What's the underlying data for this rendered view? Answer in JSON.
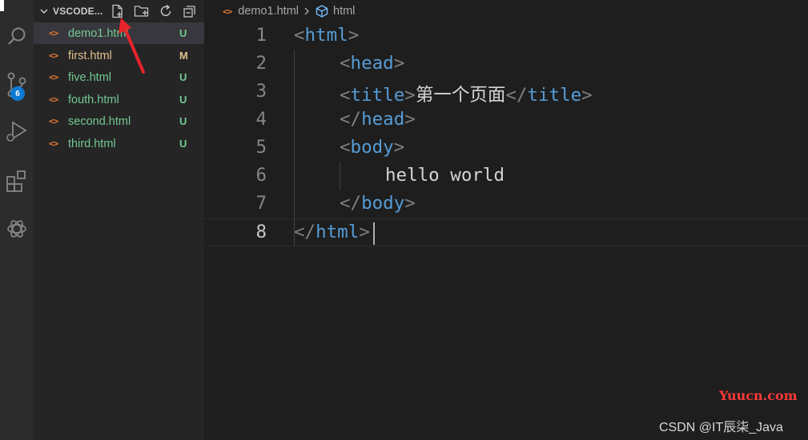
{
  "sidebar": {
    "title": "VSCODE...",
    "files": [
      {
        "name": "demo1.html",
        "status": "U",
        "selected": true
      },
      {
        "name": "first.html",
        "status": "M",
        "selected": false
      },
      {
        "name": "five.html",
        "status": "U",
        "selected": false
      },
      {
        "name": "fouth.html",
        "status": "U",
        "selected": false
      },
      {
        "name": "second.html",
        "status": "U",
        "selected": false
      },
      {
        "name": "third.html",
        "status": "U",
        "selected": false
      }
    ]
  },
  "activity": {
    "source_control_badge": "6"
  },
  "breadcrumb": {
    "file": "demo1.html",
    "symbol": "html"
  },
  "editor": {
    "current_line": 8,
    "lines": [
      {
        "n": "1",
        "tag": "html",
        "close": false,
        "text": ""
      },
      {
        "n": "2",
        "tag": "head",
        "close": false,
        "text": ""
      },
      {
        "n": "3",
        "tag": "title",
        "close": false,
        "text": "第一个页面"
      },
      {
        "n": "4",
        "tag": "head",
        "close": true,
        "text": ""
      },
      {
        "n": "5",
        "tag": "body",
        "close": false,
        "text": ""
      },
      {
        "n": "6",
        "tag": "",
        "close": false,
        "text": "hello world"
      },
      {
        "n": "7",
        "tag": "body",
        "close": true,
        "text": ""
      },
      {
        "n": "8",
        "tag": "html",
        "close": true,
        "text": ""
      }
    ]
  },
  "watermarks": {
    "site": "Yuucn.com",
    "author": "CSDN @IT辰柒_Java"
  },
  "colors": {
    "accent": "#0e7ad3",
    "tag": "#569cd6",
    "untracked": "#73c991",
    "modified": "#e2c08d",
    "file_icon": "#e37933",
    "arrow": "#e8242a"
  }
}
